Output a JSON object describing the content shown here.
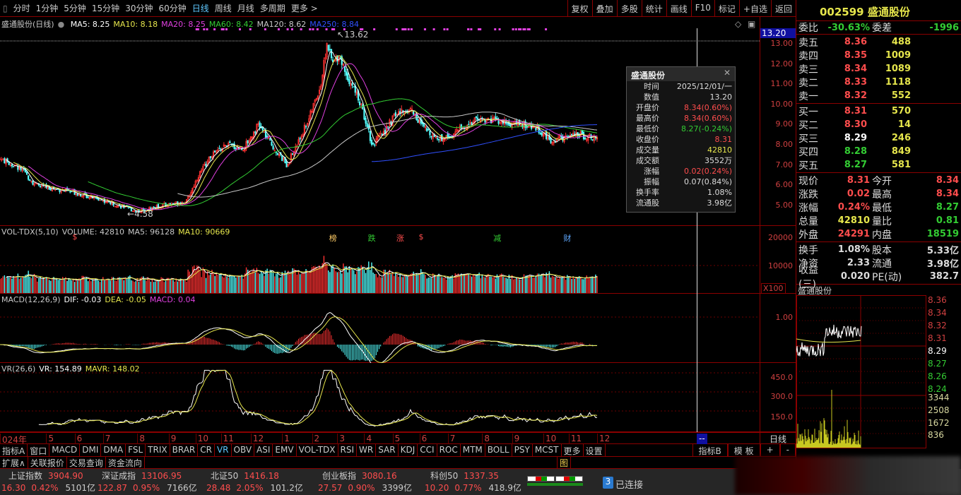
{
  "toolbar": {
    "periods": [
      "分时",
      "1分钟",
      "5分钟",
      "15分钟",
      "30分钟",
      "60分钟",
      "日线",
      "周线",
      "月线",
      "多周期",
      "更多 >"
    ],
    "active": "日线",
    "right_buttons": [
      "复权",
      "叠加",
      "多股",
      "统计",
      "画线",
      "F10",
      "标记",
      "+自选",
      "返回"
    ]
  },
  "main": {
    "title": "盛通股份(日线)",
    "ma": [
      {
        "label": "MA5: 8.25",
        "color": "#ffffff"
      },
      {
        "label": "MA10: 8.18",
        "color": "#e6e64c"
      },
      {
        "label": "MA20: 8.25",
        "color": "#e040e0"
      },
      {
        "label": "MA60: 8.42",
        "color": "#33cc33"
      },
      {
        "label": "MA120: 8.62",
        "color": "#c8c8c8"
      },
      {
        "label": "MA250: 8.84",
        "color": "#3050ff"
      }
    ],
    "high_label": "13.62",
    "low_label": "4.58",
    "cursor_price": "13.20",
    "axis": [
      "13.00",
      "12.00",
      "11.00",
      "10.00",
      "9.00",
      "8.00",
      "7.00",
      "6.00",
      "5.00"
    ],
    "markers": [
      {
        "t": "$",
        "day": 48,
        "color": "#ff4d4d"
      },
      {
        "t": "榜",
        "day": 220,
        "color": "#ffcc66"
      },
      {
        "t": "跌",
        "day": 246,
        "color": "#33cc33"
      },
      {
        "t": "涨",
        "day": 265,
        "color": "#ff4d4d"
      },
      {
        "t": "$",
        "day": 280,
        "color": "#ff4d4d"
      },
      {
        "t": "减",
        "day": 330,
        "color": "#33cc33"
      },
      {
        "t": "财",
        "day": 377,
        "color": "#5fa8ff"
      }
    ]
  },
  "tooltip": {
    "title": "盛通股份",
    "rows": [
      {
        "k": "时间",
        "v": "2025/12/01/一",
        "c": "#dddddd"
      },
      {
        "k": "数值",
        "v": "13.20",
        "c": "#dddddd"
      },
      {
        "k": "开盘价",
        "v": "8.34(0.60%)",
        "c": "#ff4d4d"
      },
      {
        "k": "最高价",
        "v": "8.34(0.60%)",
        "c": "#ff4d4d"
      },
      {
        "k": "最低价",
        "v": "8.27(-0.24%)",
        "c": "#33cc33"
      },
      {
        "k": "收盘价",
        "v": "8.31",
        "c": "#ff4d4d"
      },
      {
        "k": "成交量",
        "v": "42810",
        "c": "#e6e64c"
      },
      {
        "k": "成交额",
        "v": "3552万",
        "c": "#dddddd"
      },
      {
        "k": "涨幅",
        "v": "0.02(0.24%)",
        "c": "#ff4d4d"
      },
      {
        "k": "振幅",
        "v": "0.07(0.84%)",
        "c": "#dddddd"
      },
      {
        "k": "换手率",
        "v": "1.08%",
        "c": "#dddddd"
      },
      {
        "k": "流通股",
        "v": "3.98亿",
        "c": "#dddddd"
      }
    ]
  },
  "volume": {
    "title": "VOL-TDX(5,10)",
    "volume": "VOLUME: 42810",
    "ma5": "MA5: 96128",
    "ma10": "MA10: 90669",
    "axis": [
      "20000",
      "10000"
    ],
    "unit": "X100"
  },
  "macd": {
    "title": "MACD(12,26,9)",
    "dif": "DIF: -0.03",
    "dea": "DEA: -0.05",
    "macd": "MACD: 0.04",
    "axis": [
      "1.00"
    ]
  },
  "vr": {
    "title": "VR(26,6)",
    "vr": "VR: 154.89",
    "mavr": "MAVR: 148.02",
    "axis": [
      "450.0",
      "300.0",
      "150.0"
    ]
  },
  "date_axis": {
    "labels": [
      {
        "t": "024年",
        "day": 0
      },
      {
        "t": "5",
        "day": 31
      },
      {
        "t": "6",
        "day": 50
      },
      {
        "t": "7",
        "day": 69
      },
      {
        "t": "8",
        "day": 92
      },
      {
        "t": "9",
        "day": 113
      },
      {
        "t": "10",
        "day": 131
      },
      {
        "t": "11",
        "day": 148
      },
      {
        "t": "12",
        "day": 168
      },
      {
        "t": "1",
        "day": 189
      },
      {
        "t": "2",
        "day": 209
      },
      {
        "t": "3",
        "day": 226
      },
      {
        "t": "4",
        "day": 244
      },
      {
        "t": "5",
        "day": 263
      },
      {
        "t": "6",
        "day": 281
      },
      {
        "t": "7",
        "day": 300
      },
      {
        "t": "8",
        "day": 323
      },
      {
        "t": "9",
        "day": 343
      },
      {
        "t": "10",
        "day": 364
      },
      {
        "t": "11",
        "day": 381
      },
      {
        "t": "12",
        "day": 400
      }
    ],
    "cursor": "--",
    "period": "日线"
  },
  "tabs": {
    "items": [
      "指标A",
      "窗口",
      "MACD",
      "DMI",
      "DMA",
      "FSL",
      "TRIX",
      "BRAR",
      "CR",
      "VR",
      "OBV",
      "ASI",
      "EMV",
      "VOL-TDX",
      "RSI",
      "WR",
      "SAR",
      "KDJ",
      "CCI",
      "ROC",
      "MTM",
      "BOLL",
      "PSY",
      "MCST",
      "更多",
      "设置"
    ],
    "active": "VR",
    "right": [
      "指标B",
      "模 板",
      "+",
      "-"
    ]
  },
  "ext": {
    "items": [
      "扩展∧",
      "关联报价",
      "交易查询",
      "资金流向"
    ],
    "cut": "图"
  },
  "status": {
    "indices": [
      {
        "name": "上证指数",
        "price": "3904.90",
        "chg": "16.30",
        "pct": "0.42%",
        "amt": "5101亿"
      },
      {
        "name": "深证成指",
        "price": "13106.95",
        "chg": "122.87",
        "pct": "0.95%",
        "amt": "7166亿"
      },
      {
        "name": "北证50",
        "price": "1416.18",
        "chg": "28.48",
        "pct": "2.05%",
        "amt": "101.2亿"
      },
      {
        "name": "创业板指",
        "price": "3080.16",
        "chg": "27.57",
        "pct": "0.90%",
        "amt": "3399亿"
      },
      {
        "name": "科创50",
        "price": "1337.35",
        "chg": "10.20",
        "pct": "0.77%",
        "amt": "418.9亿"
      }
    ],
    "conn_count": "3",
    "conn_text": "已连接"
  },
  "quote": {
    "code": "002599",
    "name": "盛通股份",
    "weibi_label": "委比",
    "weibi": "-30.63%",
    "weicha_label": "委差",
    "weicha": "-1996",
    "asks": [
      {
        "l": "卖五",
        "p": "8.36",
        "v": "488"
      },
      {
        "l": "卖四",
        "p": "8.35",
        "v": "1009"
      },
      {
        "l": "卖三",
        "p": "8.34",
        "v": "1089"
      },
      {
        "l": "卖二",
        "p": "8.33",
        "v": "1118"
      },
      {
        "l": "卖一",
        "p": "8.32",
        "v": "552"
      }
    ],
    "bids": [
      {
        "l": "买一",
        "p": "8.31",
        "v": "570",
        "c": "#ff4d4d"
      },
      {
        "l": "买二",
        "p": "8.30",
        "v": "14",
        "c": "#ff4d4d"
      },
      {
        "l": "买三",
        "p": "8.29",
        "v": "246",
        "c": "#ffffff"
      },
      {
        "l": "买四",
        "p": "8.28",
        "v": "849",
        "c": "#33cc33"
      },
      {
        "l": "买五",
        "p": "8.27",
        "v": "581",
        "c": "#33cc33"
      }
    ],
    "stats1": [
      {
        "a": "现价",
        "av": "8.31",
        "ac": "#ff4d4d",
        "b": "今开",
        "bv": "8.34",
        "bc": "#ff4d4d"
      },
      {
        "a": "涨跌",
        "av": "0.02",
        "ac": "#ff4d4d",
        "b": "最高",
        "bv": "8.34",
        "bc": "#ff4d4d"
      },
      {
        "a": "涨幅",
        "av": "0.24%",
        "ac": "#ff4d4d",
        "b": "最低",
        "bv": "8.27",
        "bc": "#33cc33"
      },
      {
        "a": "总量",
        "av": "42810",
        "ac": "#e6e64c",
        "b": "量比",
        "bv": "0.81",
        "bc": "#33cc33"
      },
      {
        "a": "外盘",
        "av": "24291",
        "ac": "#ff4d4d",
        "b": "内盘",
        "bv": "18519",
        "bc": "#33cc33"
      }
    ],
    "stats2": [
      {
        "a": "换手",
        "av": "1.08%",
        "b": "股本",
        "bv": "5.33亿"
      },
      {
        "a": "净资",
        "av": "2.33",
        "b": "流通",
        "bv": "3.98亿"
      },
      {
        "a": "收益(三)",
        "av": "0.020",
        "b": "PE(动)",
        "bv": "382.7"
      }
    ]
  },
  "intraday": {
    "title": "盛通股份",
    "price_axis": [
      {
        "t": "8.36",
        "c": "#d04040"
      },
      {
        "t": "8.34",
        "c": "#d04040"
      },
      {
        "t": "8.32",
        "c": "#d04040"
      },
      {
        "t": "8.31",
        "c": "#d04040"
      },
      {
        "t": "8.29",
        "c": "#ffffff"
      },
      {
        "t": "8.27",
        "c": "#33cc33"
      },
      {
        "t": "8.26",
        "c": "#33cc33"
      },
      {
        "t": "8.24",
        "c": "#33cc33"
      }
    ],
    "vol_axis": [
      "3344",
      "2508",
      "1672",
      "836"
    ]
  },
  "chart_data": {
    "type": "candlestick",
    "total_days": 400,
    "ylim": [
      4.2,
      13.8
    ],
    "price_keypoints": [
      [
        0,
        7.3
      ],
      [
        14,
        6.8
      ],
      [
        24,
        6.0
      ],
      [
        38,
        5.8
      ],
      [
        52,
        5.6
      ],
      [
        71,
        5.2
      ],
      [
        92,
        4.7
      ],
      [
        109,
        5.0
      ],
      [
        125,
        5.2
      ],
      [
        133,
        6.5
      ],
      [
        142,
        7.5
      ],
      [
        152,
        8.0
      ],
      [
        163,
        7.8
      ],
      [
        173,
        9.0
      ],
      [
        182,
        8.0
      ],
      [
        192,
        7.0
      ],
      [
        199,
        8.0
      ],
      [
        208,
        9.5
      ],
      [
        215,
        11.0
      ],
      [
        219,
        13.0
      ],
      [
        223,
        12.0
      ],
      [
        227,
        12.5
      ],
      [
        232,
        11.5
      ],
      [
        239,
        10.5
      ],
      [
        246,
        9.0
      ],
      [
        249,
        8.0
      ],
      [
        256,
        8.5
      ],
      [
        265,
        9.5
      ],
      [
        275,
        9.8
      ],
      [
        284,
        8.8
      ],
      [
        294,
        8.3
      ],
      [
        303,
        8.5
      ],
      [
        313,
        9.0
      ],
      [
        322,
        9.3
      ],
      [
        332,
        9.2
      ],
      [
        341,
        9.0
      ],
      [
        350,
        9.0
      ],
      [
        360,
        8.8
      ],
      [
        369,
        8.2
      ],
      [
        379,
        8.4
      ],
      [
        388,
        8.5
      ],
      [
        400,
        8.31
      ]
    ]
  }
}
